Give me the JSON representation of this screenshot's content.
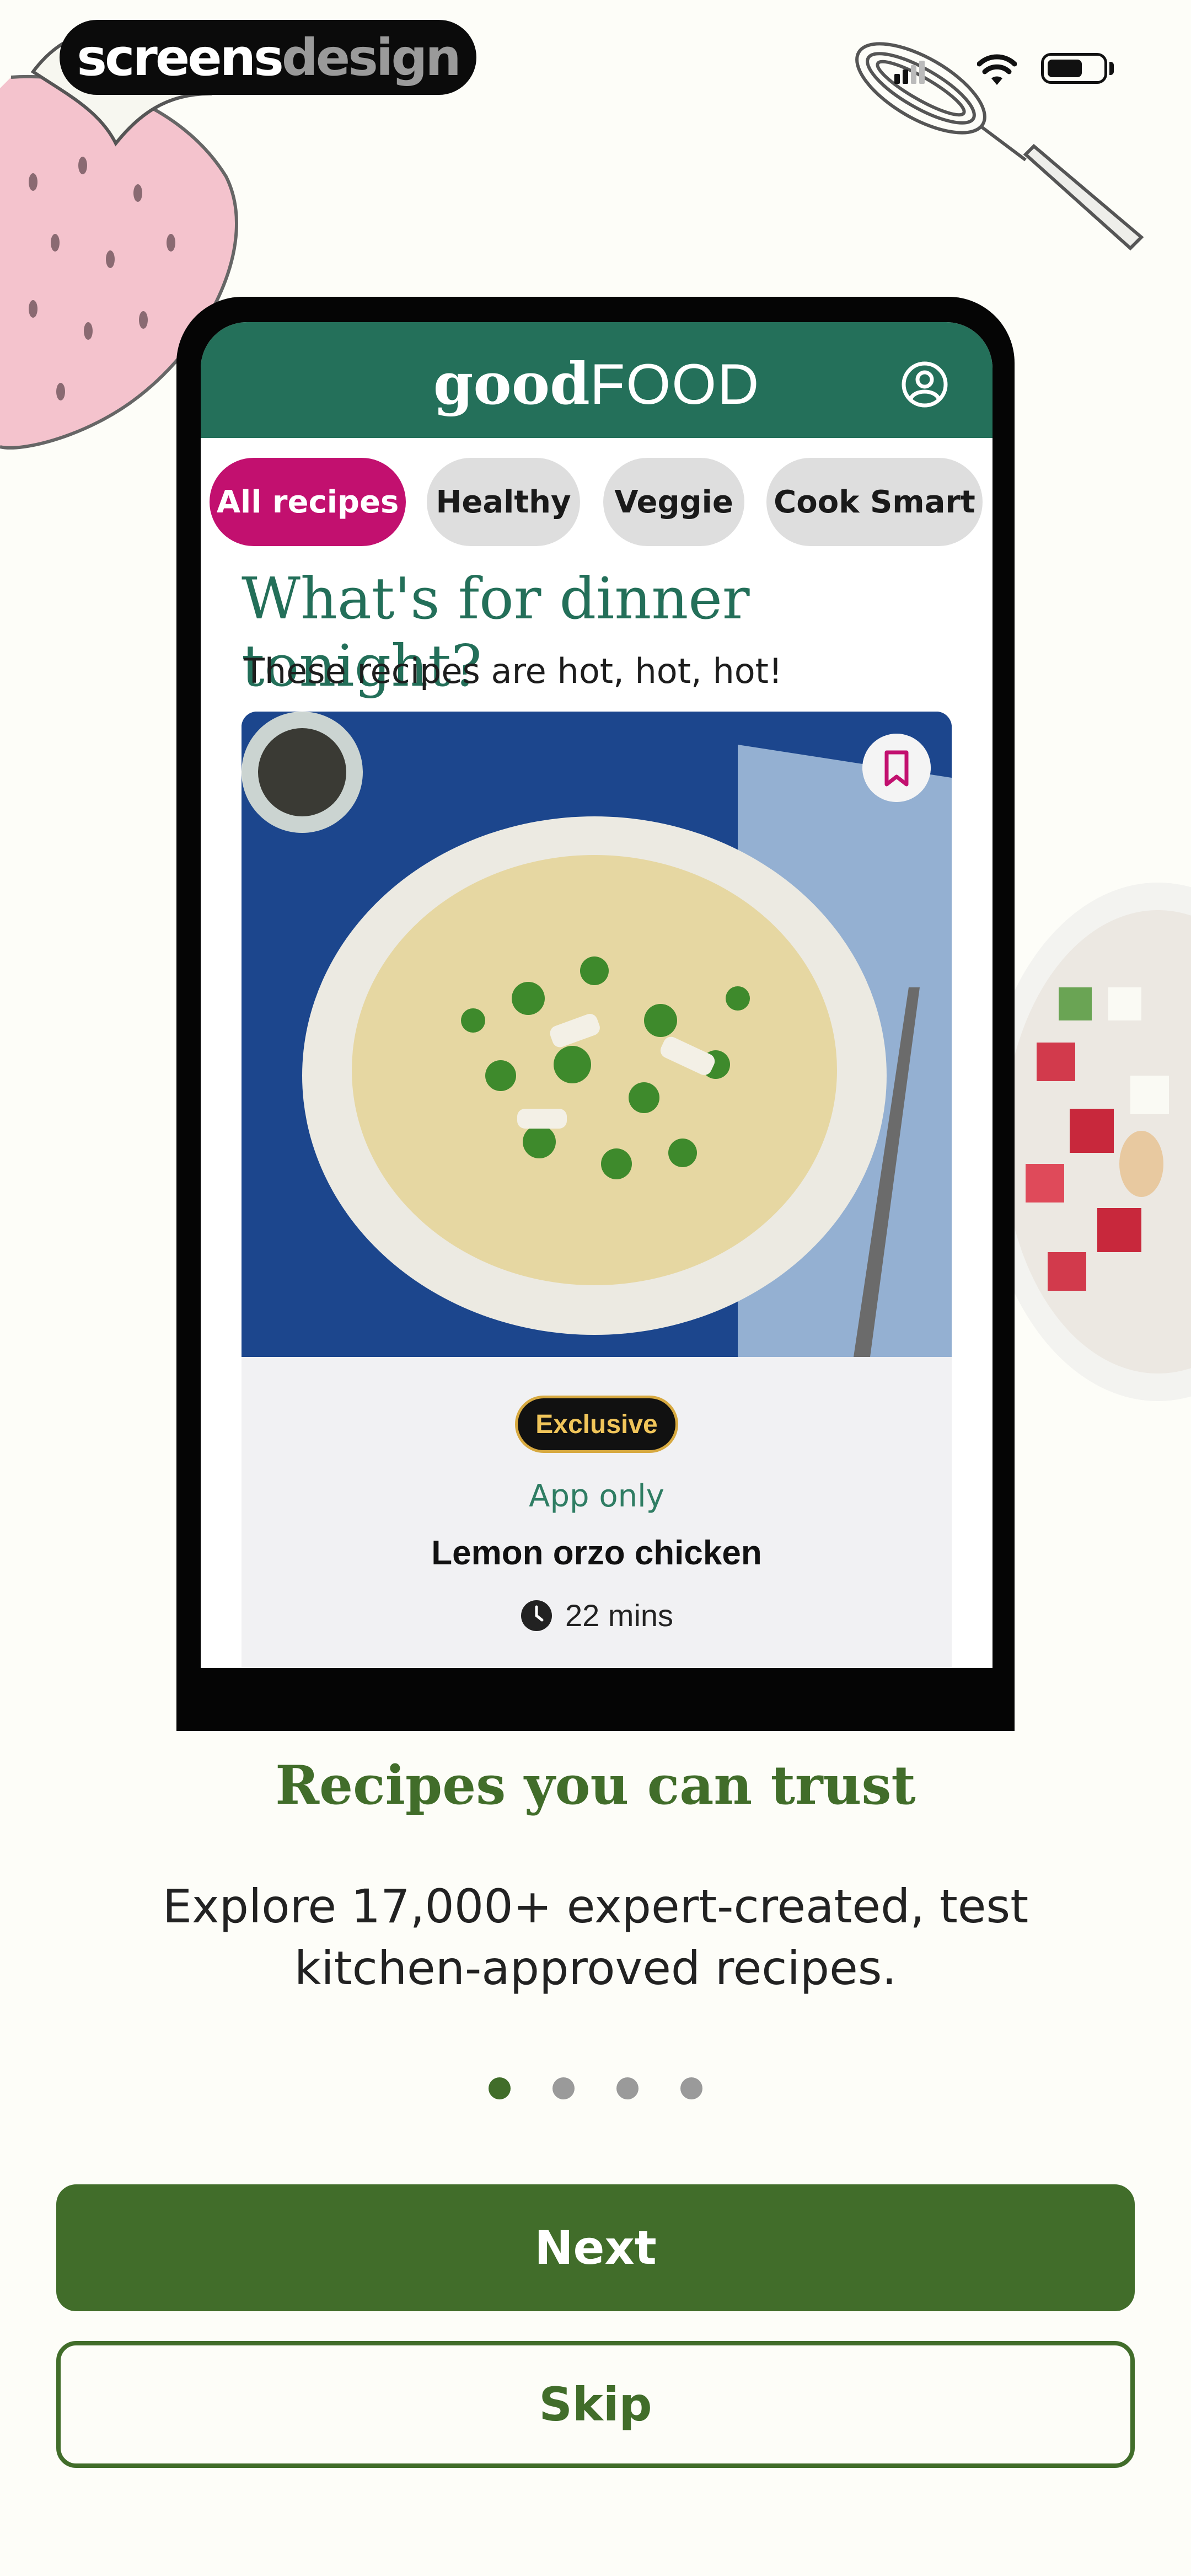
{
  "watermark": {
    "part1": "screens",
    "part2": "design"
  },
  "app": {
    "logo_bold": "good",
    "logo_light": "FOOD",
    "account_icon": "account-circle-icon",
    "chips": [
      {
        "label": "All recipes",
        "active": true
      },
      {
        "label": "Healthy",
        "active": false
      },
      {
        "label": "Veggie",
        "active": false
      },
      {
        "label": "Cook Smart",
        "active": false
      }
    ],
    "headline": "What's for dinner tonight?",
    "subline": "These recipes are hot, hot, hot!",
    "card": {
      "badge": "Exclusive",
      "tag": "App only",
      "name": "Lemon orzo chicken",
      "time": "22 mins"
    }
  },
  "onboarding": {
    "title": "Recipes you can trust",
    "description": "Explore 17,000+ expert-created, test kitchen-approved recipes.",
    "pages": 4,
    "current_page": 1,
    "next_label": "Next",
    "skip_label": "Skip"
  },
  "colors": {
    "brand_green": "#24705a",
    "primary_button": "#416d2a",
    "chip_active": "#c2106f"
  }
}
